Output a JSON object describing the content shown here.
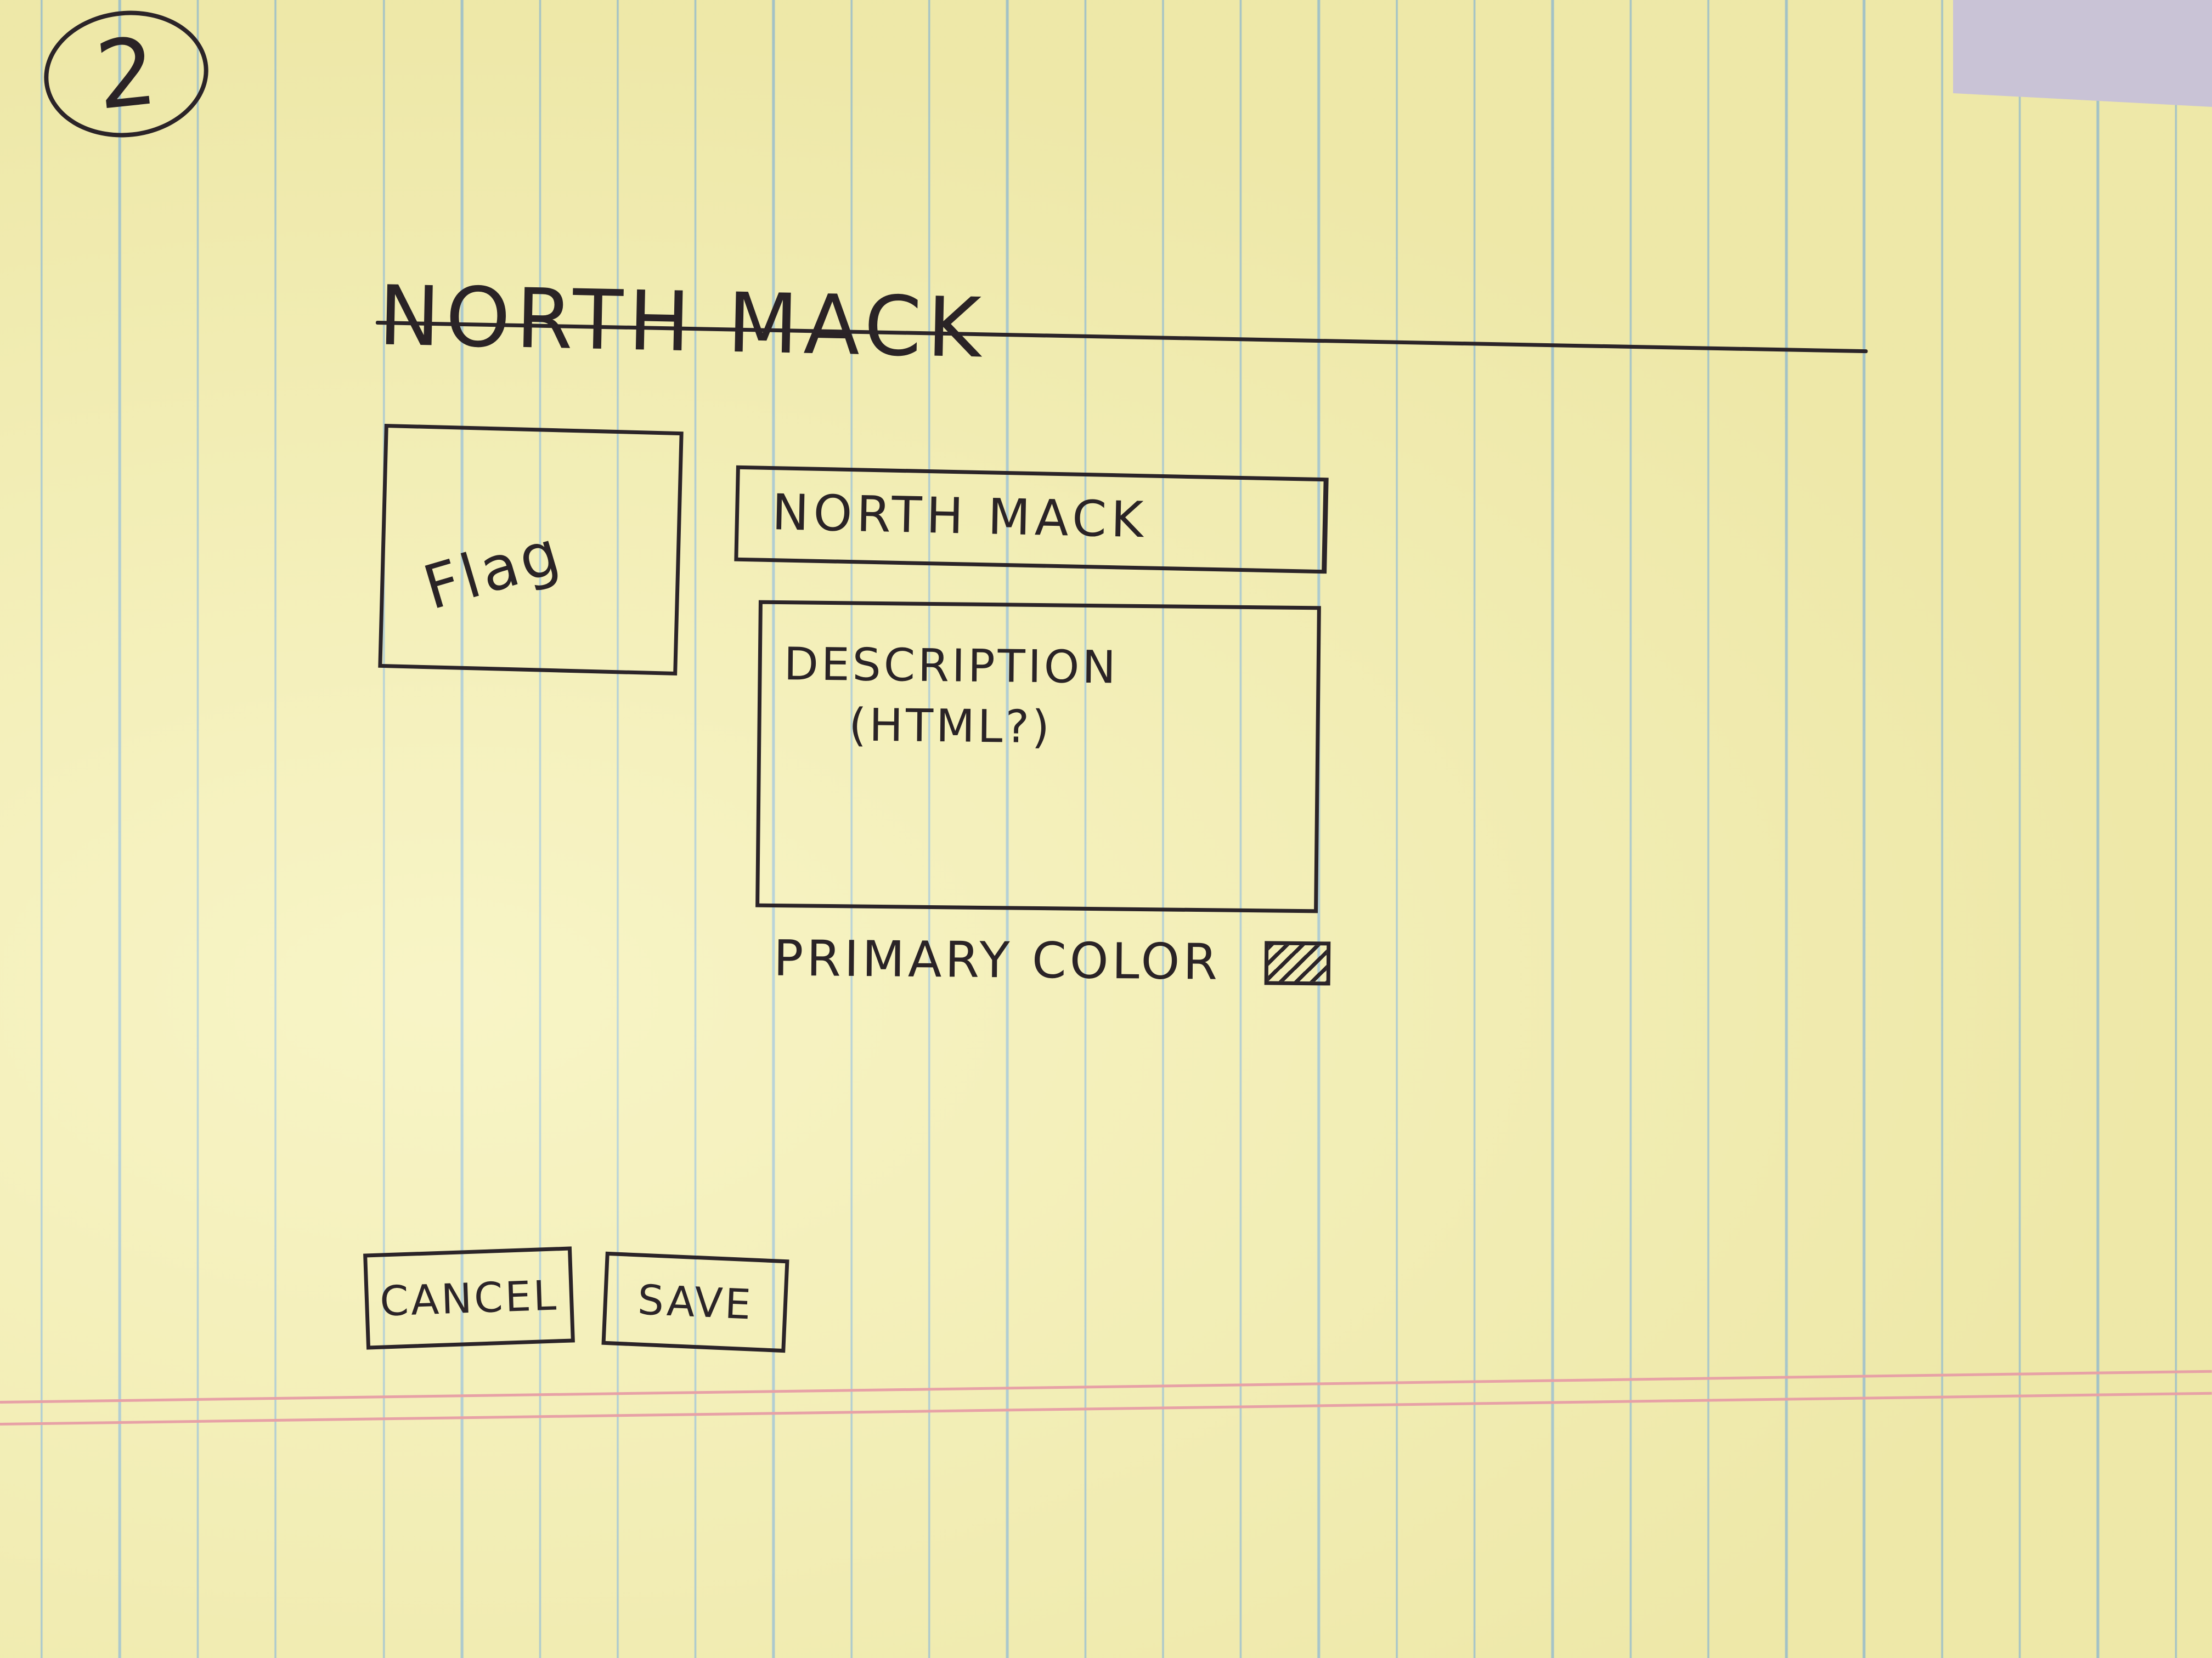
{
  "page_number": "2",
  "header": {
    "title": "North Mack"
  },
  "form": {
    "flag_label": "Flag",
    "name_value": "North Mack",
    "description_placeholder": "Description\n(HTML?)",
    "primary_color_label": "Primary Color",
    "cancel_label": "Cancel",
    "save_label": "Save"
  }
}
